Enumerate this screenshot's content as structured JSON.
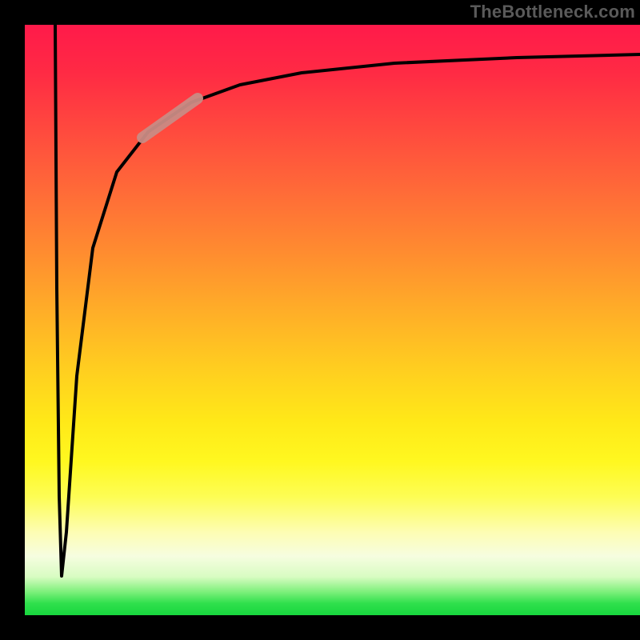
{
  "watermark": "TheBottleneck.com",
  "colors": {
    "frame": "#000000",
    "curve": "#000000",
    "highlight": "#c98b84"
  },
  "chart_data": {
    "type": "line",
    "title": "",
    "xlabel": "",
    "ylabel": "",
    "xlim": [
      0,
      100
    ],
    "ylim": [
      0,
      100
    ],
    "grid": false,
    "note": "Axes are untitled and unlabeled in the source image; values below are estimated from curve position against the plot area, scaled 0–100.",
    "series": [
      {
        "name": "curve",
        "x": [
          5.0,
          5.3,
          5.6,
          6.0,
          6.8,
          8.5,
          11,
          15,
          20,
          27,
          35,
          45,
          60,
          80,
          100
        ],
        "y": [
          100,
          55,
          20,
          7,
          14,
          40,
          62,
          75,
          82,
          87,
          90,
          92,
          93.5,
          94.5,
          95
        ]
      }
    ],
    "highlight_segment": {
      "series": "curve",
      "x_start": 20,
      "x_end": 27,
      "note": "Short thick pink stroke overlaid on the curve in this x-range."
    }
  }
}
